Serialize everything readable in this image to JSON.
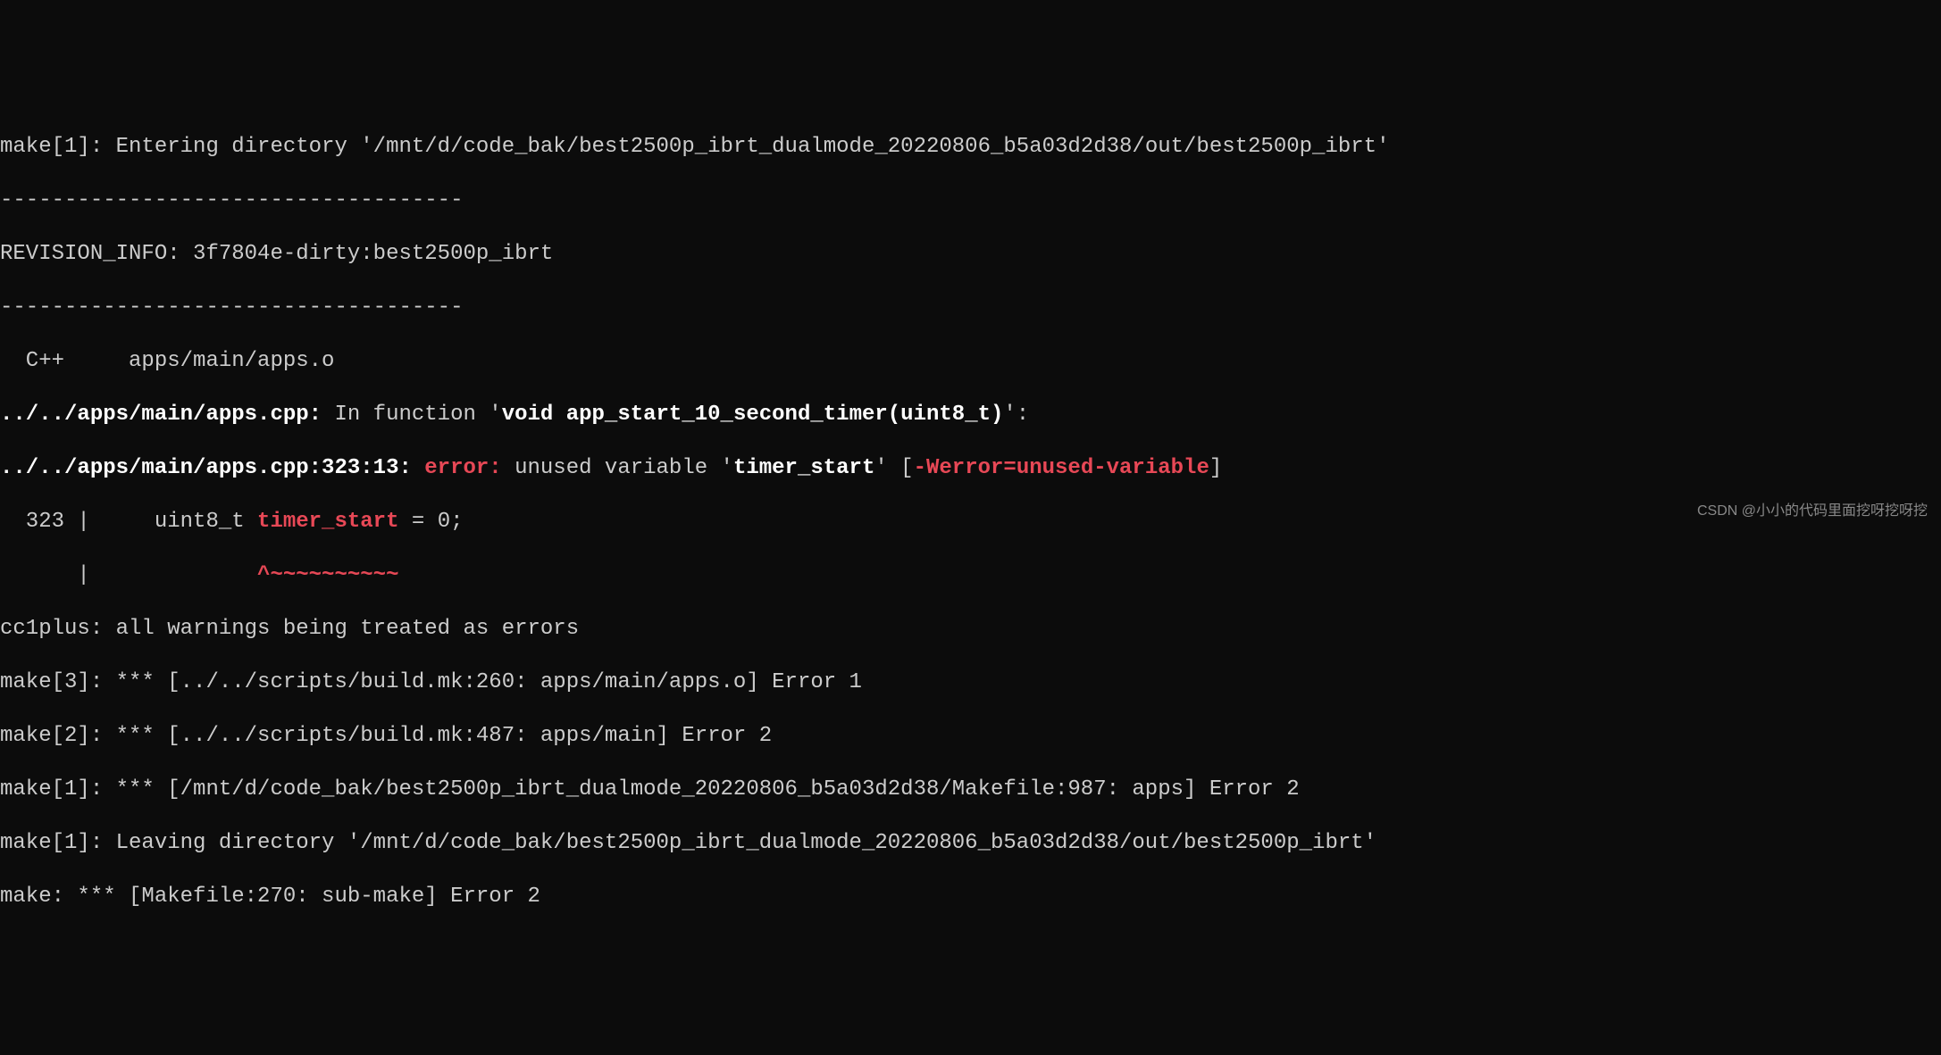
{
  "lines": {
    "l1_pre": "make[1]: Entering directory '",
    "l1_path": "/mnt/d/code_bak/best2500p_ibrt_dualmode_20220806_b5a03d2d38/out/best2500p_ibrt",
    "l1_post": "'",
    "l2": "------------------------------------",
    "l3": "REVISION_INFO: 3f7804e-dirty:best2500p_ibrt",
    "l4": "------------------------------------",
    "l5": "  C++     apps/main/apps.o",
    "l6_file": "../../apps/main/apps.cpp:",
    "l6_infunc": " In function '",
    "l6_sig": "void app_start_10_second_timer(uint8_t)",
    "l6_post": "':",
    "l7_file": "../../apps/main/apps.cpp:323:13:",
    "l7_error": " error: ",
    "l7_msg": "unused variable '",
    "l7_var": "timer_start",
    "l7_msg2": "' [",
    "l7_flag": "-Werror=unused-variable",
    "l7_msg3": "]",
    "l8_pre": "  323 |     uint8_t ",
    "l8_var": "timer_start",
    "l8_post": " = 0;",
    "l9_pre": "      |             ",
    "l9_caret": "^~~~~~~~~~~",
    "l10": "cc1plus: all warnings being treated as errors",
    "l11": "make[3]: *** [../../scripts/build.mk:260: apps/main/apps.o] Error 1",
    "l12": "make[2]: *** [../../scripts/build.mk:487: apps/main] Error 2",
    "l13": "make[1]: *** [/mnt/d/code_bak/best2500p_ibrt_dualmode_20220806_b5a03d2d38/Makefile:987: apps] Error 2",
    "l14_pre": "make[1]: Leaving directory '",
    "l14_path": "/mnt/d/code_bak/best2500p_ibrt_dualmode_20220806_b5a03d2d38/out/best2500p_ibrt",
    "l14_post": "'",
    "l15": "make: *** [Makefile:270: sub-make] Error 2"
  },
  "watermark": "CSDN @小小的代码里面挖呀挖呀挖"
}
